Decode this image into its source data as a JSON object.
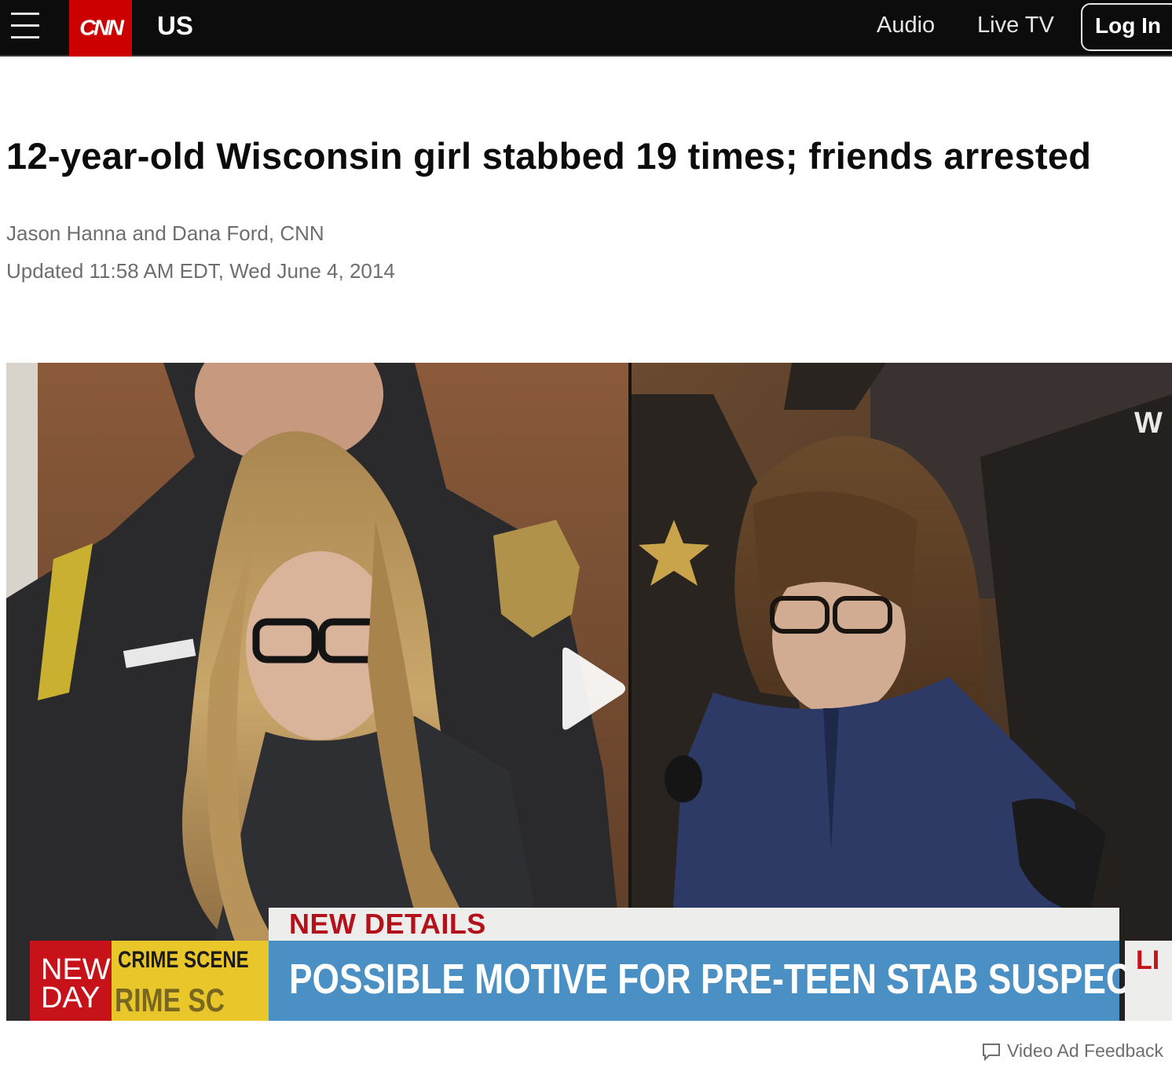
{
  "header": {
    "menu_icon": "hamburger-menu-icon",
    "logo_text": "CNN",
    "edition": "US",
    "nav": {
      "audio": "Audio",
      "live_tv": "Live TV"
    },
    "login_label": "Log In",
    "colors": {
      "bar": "#0c0c0c",
      "logo_red": "#cc0000"
    }
  },
  "article": {
    "headline": "12-year-old Wisconsin girl stabbed 19 times; friends arrested",
    "byline": "Jason Hanna and Dana Ford, CNN",
    "timestamp": "Updated 11:58 AM EDT, Wed June 4, 2014"
  },
  "video": {
    "play_icon": "play-icon",
    "chyron_top": "NEW DETAILS",
    "chyron_main": "POSSIBLE MOTIVE FOR PRE-TEEN STAB SUSPECTS",
    "show_badge": {
      "line1": "NEW",
      "line2": "DAY"
    },
    "tape_text": {
      "line1": "CRIME SCENE",
      "line2": "RIME SC"
    },
    "corner_bug": "LI",
    "watermark": "W"
  },
  "ad_feedback": {
    "icon": "speech-bubble-icon",
    "label": "Video Ad Feedback"
  }
}
